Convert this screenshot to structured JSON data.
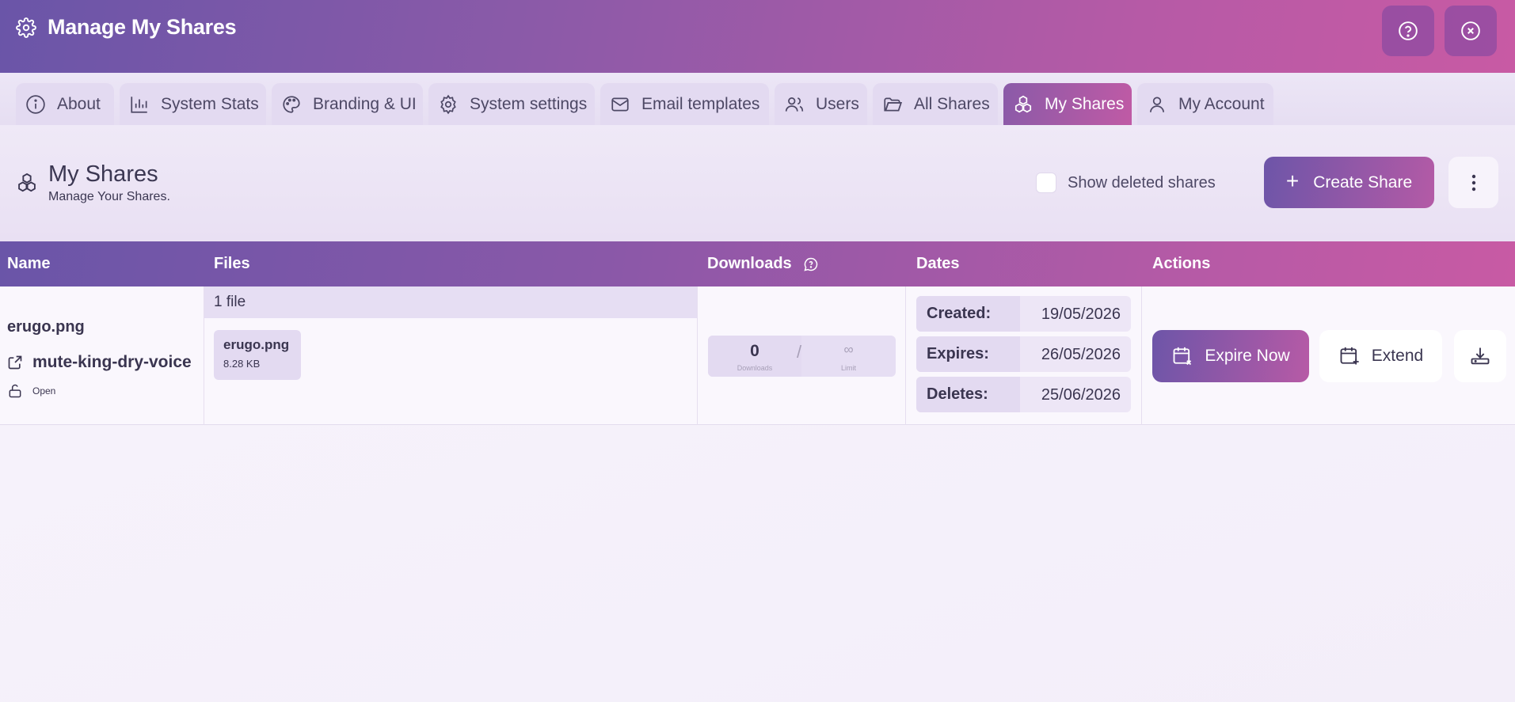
{
  "header": {
    "title": "Manage My Shares"
  },
  "tabs": [
    {
      "label": "About",
      "icon": "info-icon"
    },
    {
      "label": "System Stats",
      "icon": "bar-chart-icon"
    },
    {
      "label": "Branding & UI",
      "icon": "palette-icon"
    },
    {
      "label": "System settings",
      "icon": "gear-icon"
    },
    {
      "label": "Email templates",
      "icon": "mail-icon"
    },
    {
      "label": "Users",
      "icon": "users-icon"
    },
    {
      "label": "All Shares",
      "icon": "folder-icon"
    },
    {
      "label": "My Shares",
      "icon": "cubes-icon",
      "active": true
    },
    {
      "label": "My Account",
      "icon": "user-icon"
    }
  ],
  "page": {
    "title": "My Shares",
    "subtitle": "Manage Your Shares.",
    "show_deleted_label": "Show deleted shares",
    "create_label": "Create Share"
  },
  "table": {
    "columns": [
      "Name",
      "Files",
      "Downloads",
      "Dates",
      "Actions"
    ],
    "rows": [
      {
        "file_name": "erugo.png",
        "share_name": "mute-king-dry-voice",
        "status": "Open",
        "files_count": "1 file",
        "file": {
          "name": "erugo.png",
          "size": "8.28 KB"
        },
        "downloads": {
          "count": "0",
          "count_label": "Downloads",
          "separator": "/",
          "limit": "∞",
          "limit_label": "Limit"
        },
        "dates": {
          "created_label": "Created:",
          "created": "19/05/2026",
          "expires_label": "Expires:",
          "expires": "26/05/2026",
          "deletes_label": "Deletes:",
          "deletes": "25/06/2026"
        },
        "actions": {
          "expire_label": "Expire Now",
          "extend_label": "Extend"
        }
      }
    ]
  },
  "colors": {
    "accent_start": "#6a55a8",
    "accent_end": "#c85aa4",
    "background": "#f5f1fa"
  }
}
